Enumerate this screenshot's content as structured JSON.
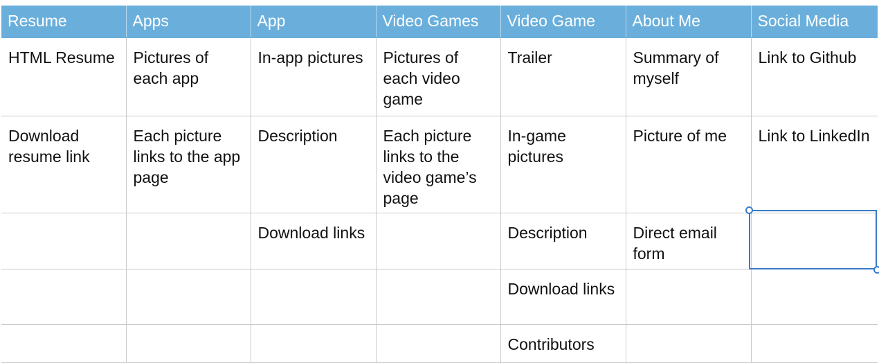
{
  "table": {
    "headers": [
      "Resume",
      "Apps",
      "App",
      "Video Games",
      "Video Game",
      "About Me",
      "Social Media"
    ],
    "rows": [
      [
        "HTML Resume",
        "Pictures of each app",
        "In-app pictures",
        "Pictures of each video game",
        "Trailer",
        "Summary of myself",
        "Link to Github"
      ],
      [
        "Download resume link",
        "Each picture links to the app page",
        "Description",
        "Each picture links to the video game’s page",
        "In-game pictures",
        "Picture of me",
        "Link to LinkedIn"
      ],
      [
        "",
        "",
        "Download links",
        "",
        "Description",
        "Direct email form",
        ""
      ],
      [
        "",
        "",
        "",
        "",
        "Download links",
        "",
        ""
      ],
      [
        "",
        "",
        "",
        "",
        "Contributors",
        "",
        ""
      ]
    ]
  },
  "colors": {
    "header_background": "#6aafdc",
    "header_text": "#ffffff",
    "grid_line": "#c9c9c9",
    "selection": "#3a7bc8"
  }
}
